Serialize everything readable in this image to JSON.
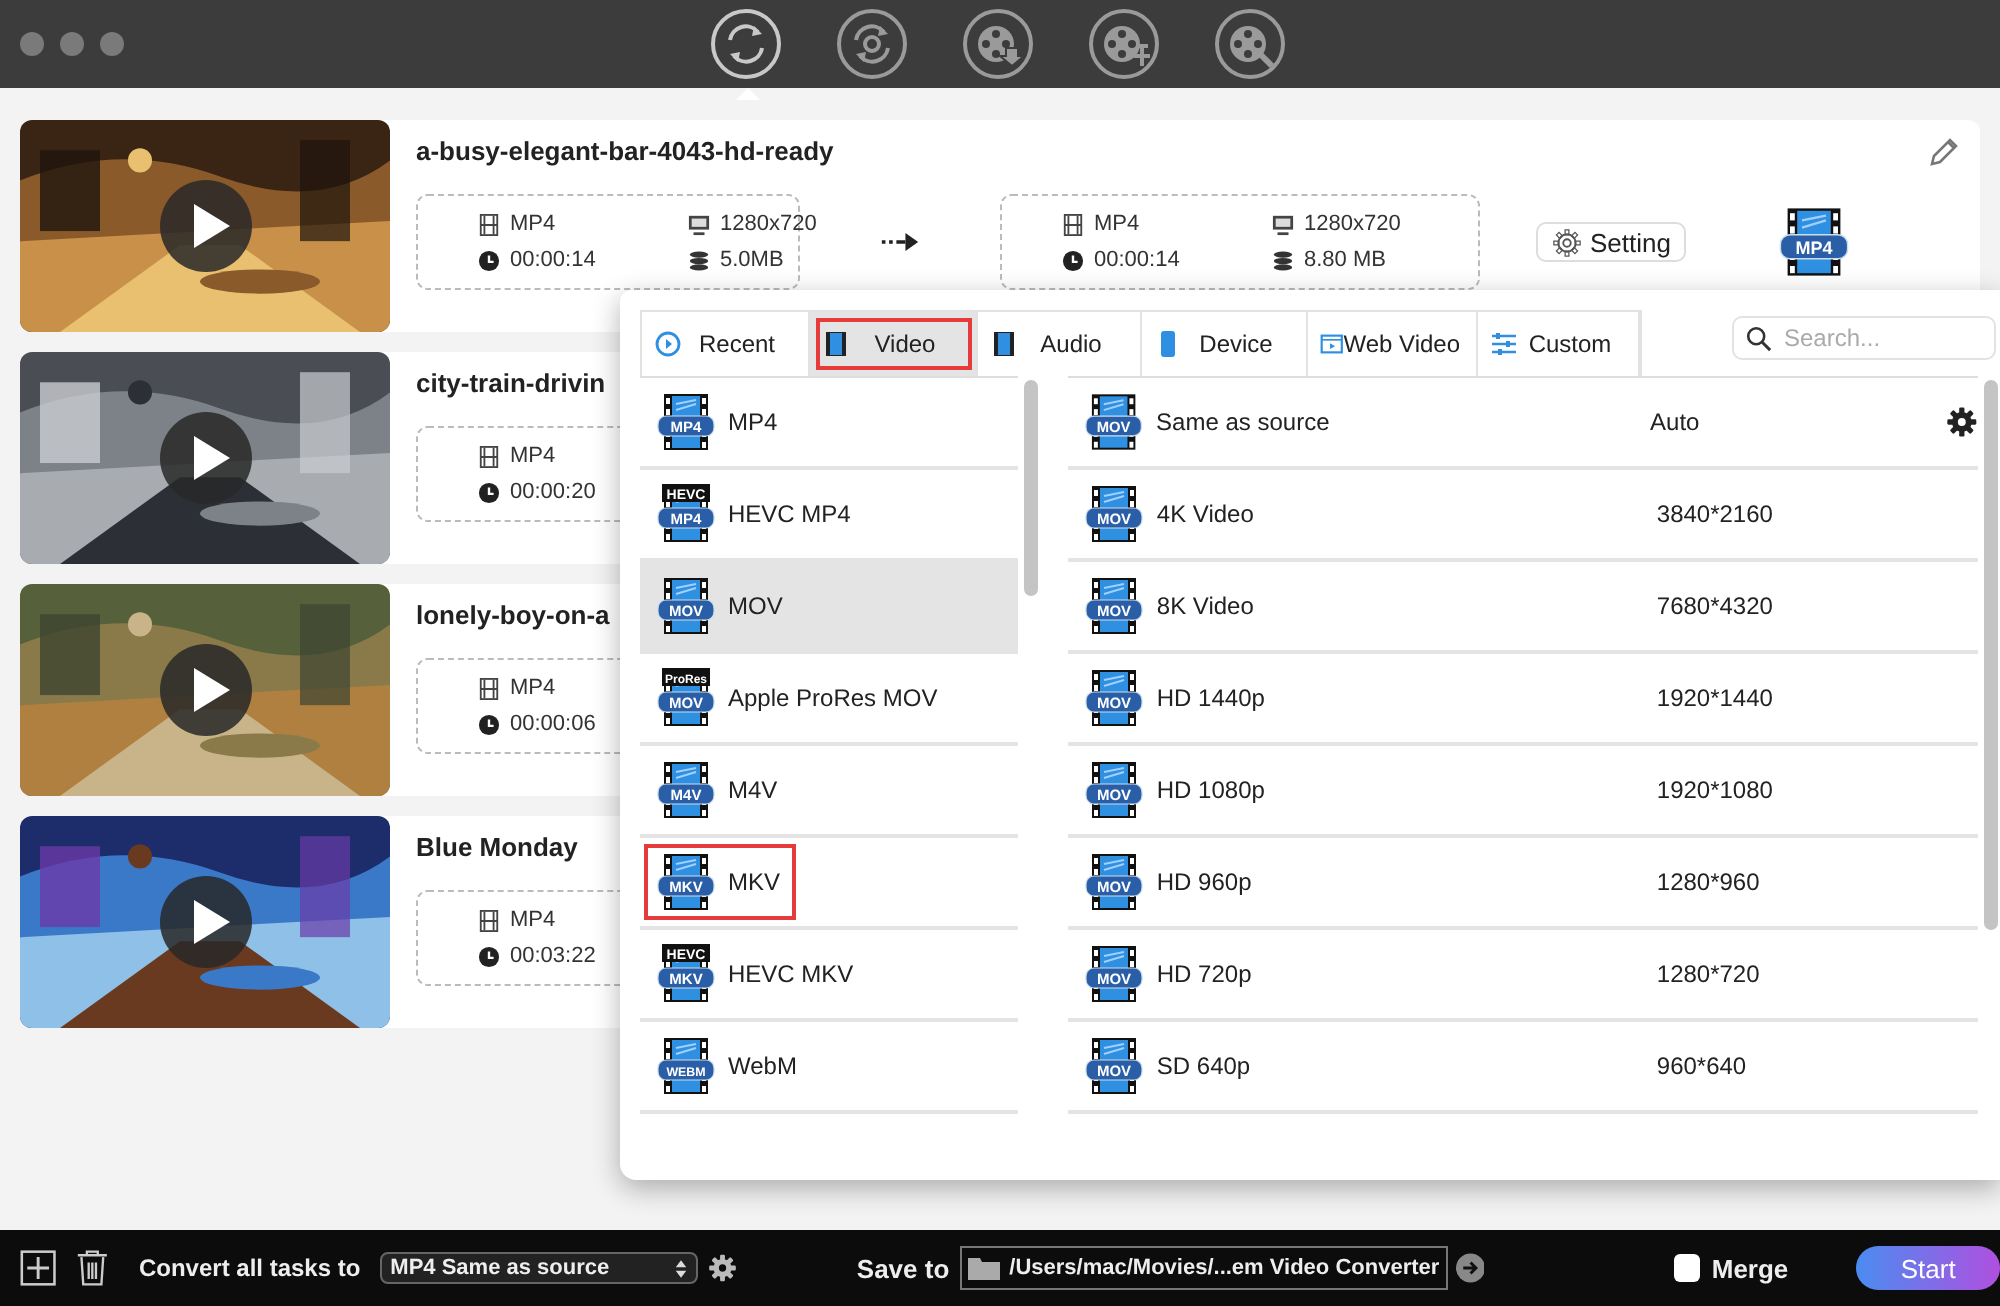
{
  "toolbar": [
    {
      "kind": "convert",
      "selected": true
    },
    {
      "kind": "convert-disc",
      "selected": false
    },
    {
      "kind": "reel-download",
      "selected": false
    },
    {
      "kind": "reel-edit",
      "selected": false
    },
    {
      "kind": "reel-tools",
      "selected": false
    }
  ],
  "tasks": [
    {
      "title": "a-busy-elegant-bar-4043-hd-ready",
      "source": {
        "format": "MP4",
        "duration": "00:00:14",
        "resolution": "1280x720",
        "size": "5.0MB"
      },
      "target": {
        "format": "MP4",
        "duration": "00:00:14",
        "resolution": "1280x720",
        "size": "8.80 MB"
      },
      "setting": "Setting",
      "target_icon": "MP4"
    },
    {
      "title": "city-train-drivin",
      "source": {
        "format": "MP4",
        "duration": "00:00:20"
      }
    },
    {
      "title": "lonely-boy-on-a",
      "source": {
        "format": "MP4",
        "duration": "00:00:06"
      }
    },
    {
      "title": "Blue Monday",
      "source": {
        "format": "MP4",
        "duration": "00:03:22"
      }
    }
  ],
  "popup": {
    "tabs": [
      {
        "kind": "recent",
        "label": "Recent",
        "selected": false,
        "highlighted": false
      },
      {
        "kind": "video",
        "label": "Video",
        "selected": true,
        "highlighted": true
      },
      {
        "kind": "audio",
        "label": "Audio",
        "selected": false,
        "highlighted": false
      },
      {
        "kind": "device",
        "label": "Device",
        "selected": false,
        "highlighted": false
      },
      {
        "kind": "web",
        "label": "Web Video",
        "selected": false,
        "highlighted": false
      },
      {
        "kind": "custom",
        "label": "Custom",
        "selected": false,
        "highlighted": false
      }
    ],
    "search": {
      "placeholder": "Search..."
    },
    "formats": [
      {
        "icon_label": "MP4",
        "name": "MP4",
        "selected": false,
        "highlighted": false
      },
      {
        "icon_top": "HEVC",
        "icon_label": "MP4",
        "name": "HEVC MP4",
        "selected": false,
        "highlighted": false
      },
      {
        "icon_label": "MOV",
        "name": "MOV",
        "selected": true,
        "highlighted": false
      },
      {
        "icon_top": "ProRes",
        "icon_label": "MOV",
        "name": "Apple ProRes MOV",
        "selected": false,
        "highlighted": false
      },
      {
        "icon_label": "M4V",
        "name": "M4V",
        "selected": false,
        "highlighted": false
      },
      {
        "icon_label": "MKV",
        "name": "MKV",
        "selected": false,
        "highlighted": true
      },
      {
        "icon_top": "HEVC",
        "icon_label": "MKV",
        "name": "HEVC MKV",
        "selected": false,
        "highlighted": false
      },
      {
        "icon_label": "WEBM",
        "name": "WebM",
        "selected": false,
        "highlighted": false
      }
    ],
    "presets": [
      {
        "icon_label": "MOV",
        "name": "Same as source",
        "resolution": "Auto",
        "gear": true
      },
      {
        "icon_label": "MOV",
        "name": "4K Video",
        "resolution": "3840*2160"
      },
      {
        "icon_label": "MOV",
        "name": "8K Video",
        "resolution": "7680*4320"
      },
      {
        "icon_label": "MOV",
        "name": "HD 1440p",
        "resolution": "1920*1440"
      },
      {
        "icon_label": "MOV",
        "name": "HD 1080p",
        "resolution": "1920*1080"
      },
      {
        "icon_label": "MOV",
        "name": "HD 960p",
        "resolution": "1280*960"
      },
      {
        "icon_label": "MOV",
        "name": "HD 720p",
        "resolution": "1280*720"
      },
      {
        "icon_label": "MOV",
        "name": "SD 640p",
        "resolution": "960*640"
      }
    ]
  },
  "bottom_bar": {
    "convert_label": "Convert all tasks to",
    "convert_value": "MP4 Same as source",
    "save_label": "Save to",
    "save_path": "/Users/mac/Movies/...em Video Converter",
    "merge": {
      "label": "Merge",
      "checked": false
    },
    "start": "Start"
  }
}
